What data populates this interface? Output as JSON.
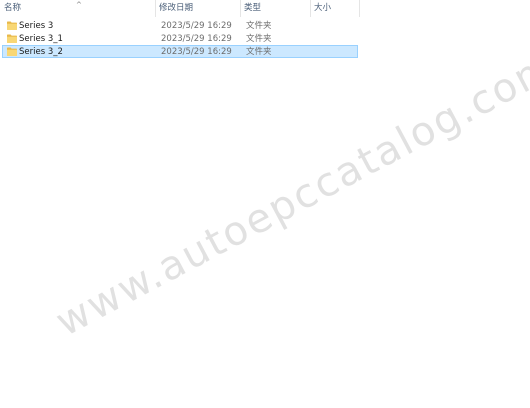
{
  "header": {
    "col_name": "名称",
    "col_date": "修改日期",
    "col_type": "类型",
    "col_size": "大小"
  },
  "files": [
    {
      "name": "Series 3",
      "date": "2023/5/29 16:29",
      "type": "文件夹",
      "size": ""
    },
    {
      "name": "Series 3_1",
      "date": "2023/5/29 16:29",
      "type": "文件夹",
      "size": ""
    },
    {
      "name": "Series 3_2",
      "date": "2023/5/29 16:29",
      "type": "文件夹",
      "size": ""
    }
  ],
  "selected_index": 2,
  "watermark": "www.autoepccatalog.com",
  "colors": {
    "selection_bg": "#cce8ff",
    "selection_border": "#99d1ff",
    "folder_yellow": "#f8d775"
  },
  "icons": {
    "folder": "folder-icon",
    "sort": "sort-up-icon"
  }
}
